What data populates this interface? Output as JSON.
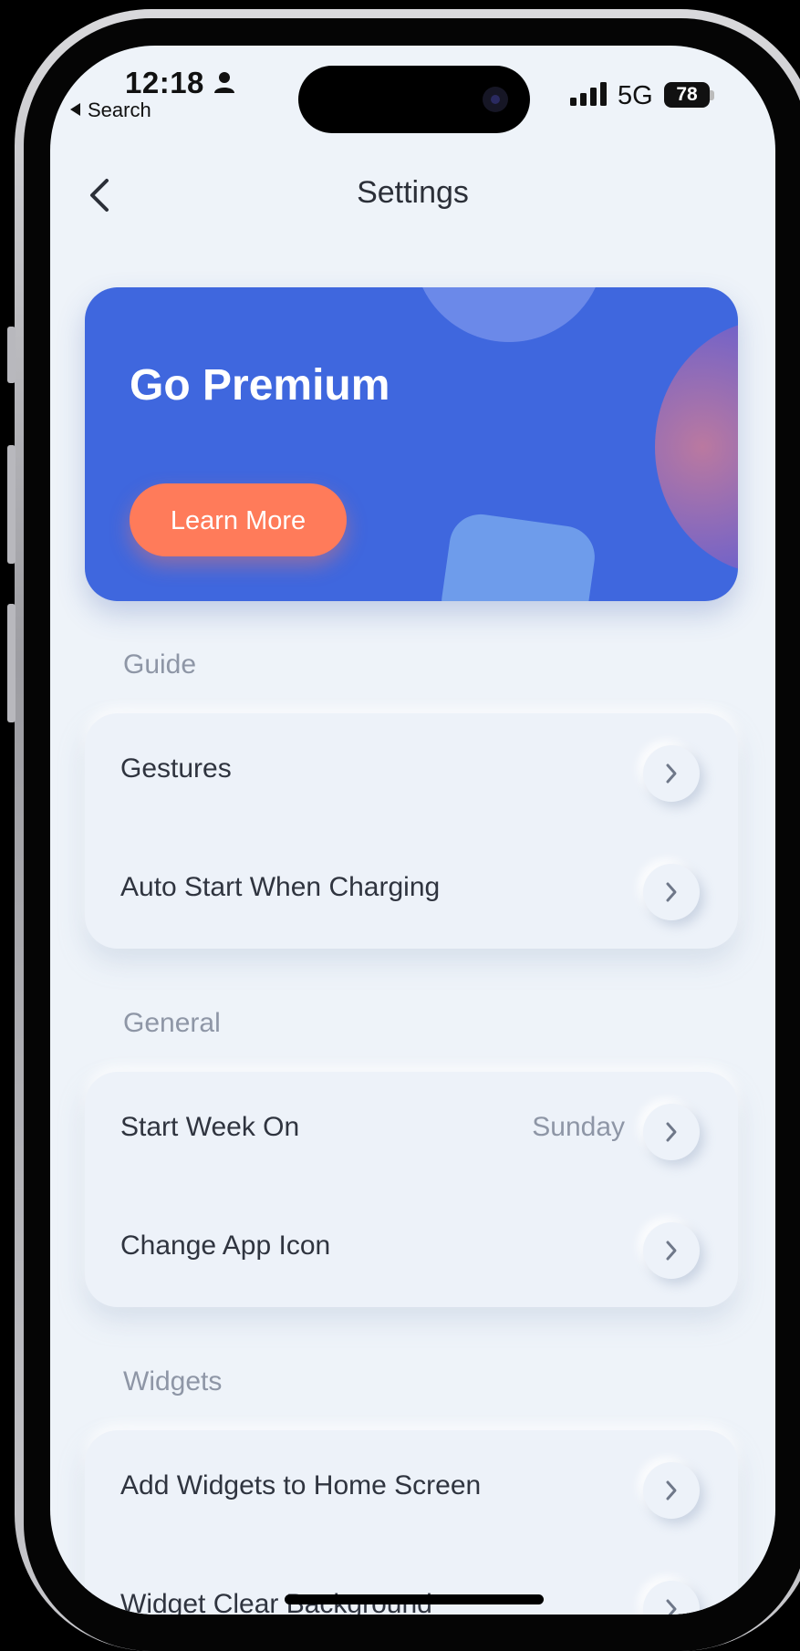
{
  "status_bar": {
    "time": "12:18",
    "back_app": "Search",
    "network": "5G",
    "battery": "78"
  },
  "nav": {
    "title": "Settings"
  },
  "premium": {
    "title": "Go Premium",
    "button_label": "Learn More",
    "accent": "#3f67de",
    "button_color": "#ff7b5a"
  },
  "sections": {
    "guide": {
      "label": "Guide",
      "rows": [
        {
          "label": "Gestures"
        },
        {
          "label": "Auto Start When Charging"
        }
      ]
    },
    "general": {
      "label": "General",
      "rows": [
        {
          "label": "Start Week On",
          "value": "Sunday"
        },
        {
          "label": "Change App Icon"
        }
      ]
    },
    "widgets": {
      "label": "Widgets",
      "rows": [
        {
          "label": "Add Widgets to Home Screen"
        },
        {
          "label": "Widget Clear Background"
        }
      ]
    }
  },
  "icons": {
    "back": "chevron-left-icon",
    "row_action": "chevron-right-icon",
    "person": "person-icon",
    "signal": "cellular-signal-icon"
  }
}
